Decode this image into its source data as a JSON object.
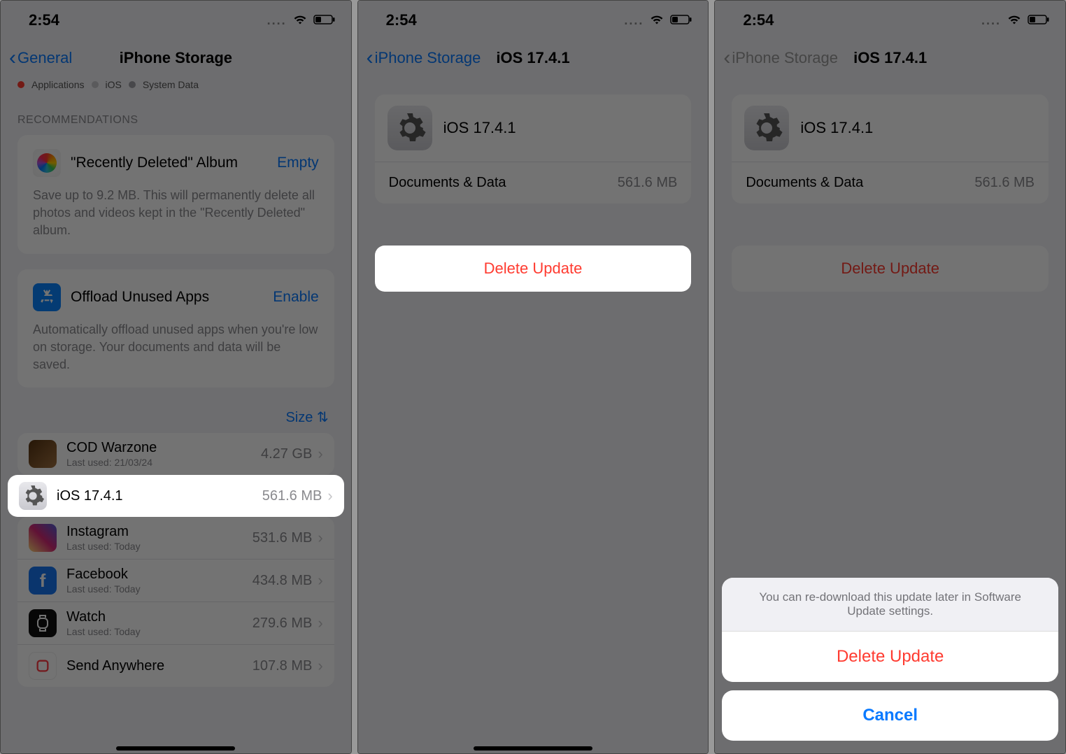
{
  "status": {
    "time": "2:54"
  },
  "panel1": {
    "back": "General",
    "title": "iPhone Storage",
    "legend": {
      "a": "Applications",
      "b": "iOS",
      "c": "System Data"
    },
    "recs_header": "RECOMMENDATIONS",
    "rec1": {
      "title": "\"Recently Deleted\" Album",
      "action": "Empty",
      "desc": "Save up to 9.2 MB. This will permanently delete all photos and videos kept in the \"Recently Deleted\" album."
    },
    "rec2": {
      "title": "Offload Unused Apps",
      "action": "Enable",
      "desc": "Automatically offload unused apps when you're low on storage. Your documents and data will be saved."
    },
    "sort": "Size",
    "apps": {
      "0": {
        "name": "COD Warzone",
        "sub": "Last used: 21/03/24",
        "size": "4.27 GB"
      },
      "1": {
        "name": "iOS 17.4.1",
        "sub": "",
        "size": "561.6 MB"
      },
      "2": {
        "name": "Instagram",
        "sub": "Last used: Today",
        "size": "531.6 MB"
      },
      "3": {
        "name": "Facebook",
        "sub": "Last used: Today",
        "size": "434.8 MB"
      },
      "4": {
        "name": "Watch",
        "sub": "Last used: Today",
        "size": "279.6 MB"
      },
      "5": {
        "name": "Send Anywhere",
        "sub": "",
        "size": "107.8 MB"
      }
    }
  },
  "panel2": {
    "back": "iPhone Storage",
    "title": "iOS 17.4.1",
    "item_title": "iOS 17.4.1",
    "docs_label": "Documents & Data",
    "docs_value": "561.6 MB",
    "delete": "Delete Update"
  },
  "panel3": {
    "back": "iPhone Storage",
    "title": "iOS 17.4.1",
    "item_title": "iOS 17.4.1",
    "docs_label": "Documents & Data",
    "docs_value": "561.6 MB",
    "delete": "Delete Update",
    "sheet_msg": "You can re-download this update later in Software Update settings.",
    "sheet_delete": "Delete Update",
    "sheet_cancel": "Cancel"
  }
}
